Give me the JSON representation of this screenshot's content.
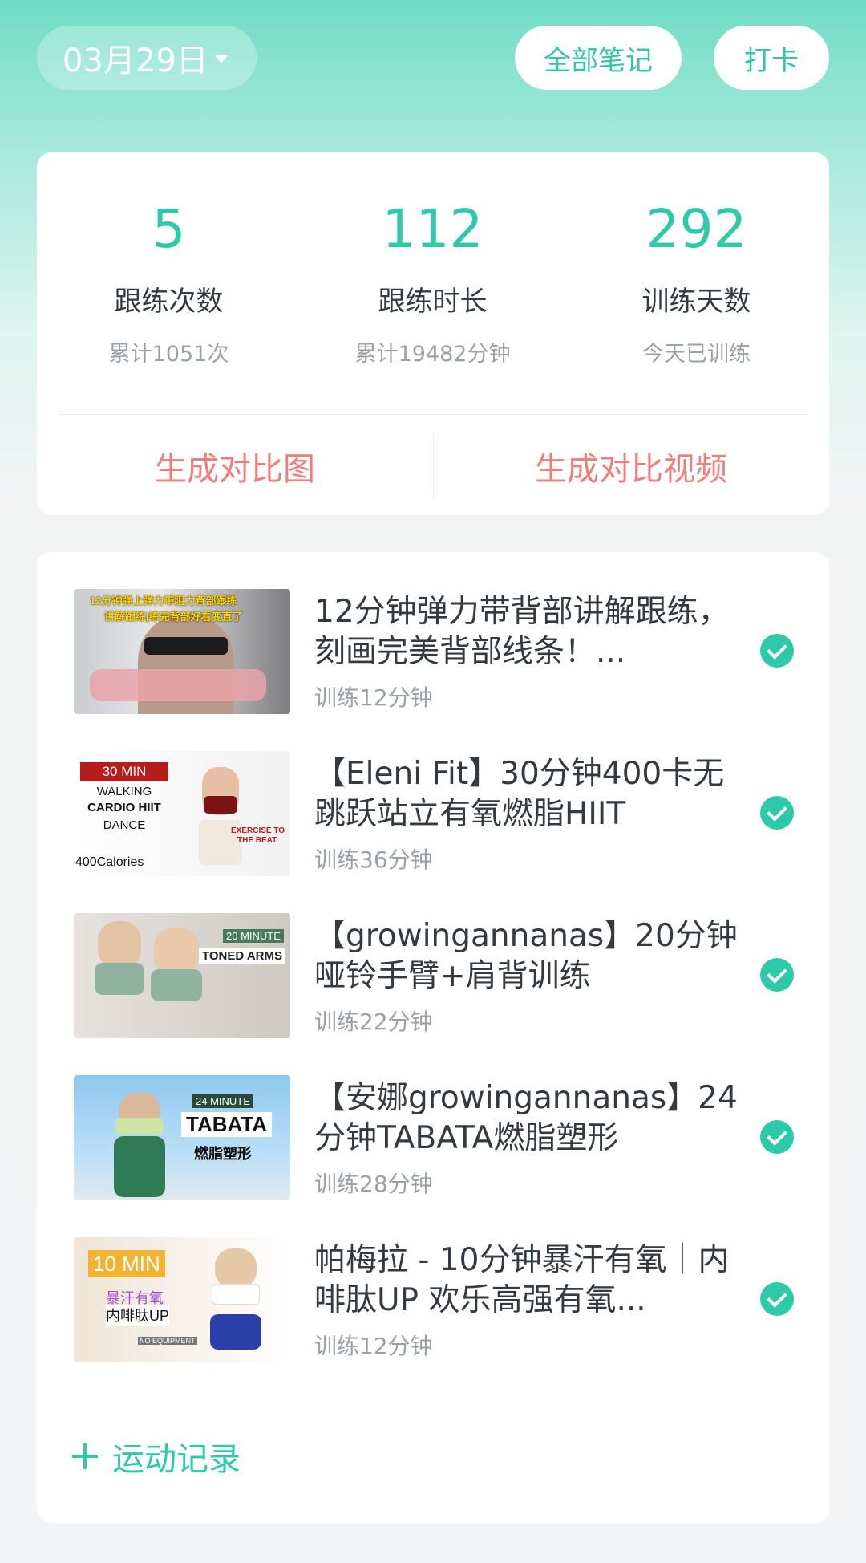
{
  "header": {
    "date": "03月29日",
    "all_notes": "全部笔记",
    "check_in": "打卡"
  },
  "stats": [
    {
      "value": "5",
      "label": "跟练次数",
      "sub": "累计1051次"
    },
    {
      "value": "112",
      "label": "跟练时长",
      "sub": "累计19482分钟"
    },
    {
      "value": "292",
      "label": "训练天数",
      "sub": "今天已训练"
    }
  ],
  "compare": {
    "image": "生成对比图",
    "video": "生成对比视频"
  },
  "workouts": [
    {
      "title": "12分钟弹力带背部讲解跟练，刻画完美背部线条！...",
      "sub": "训练12分钟",
      "thumb_text": [
        "12分钟弹上弹力带阻力背部跟练",
        "讲解跟练|练完背部好看变直了"
      ]
    },
    {
      "title": "【Eleni Fit】30分钟400卡无跳跃站立有氧燃脂HIIT",
      "sub": "训练36分钟",
      "thumb_text": [
        "30 MIN",
        "WALKING",
        "CARDIO HIIT",
        "DANCE",
        "EXERCISE TO",
        "THE BEAT",
        "400Calories"
      ]
    },
    {
      "title": "【growingannanas】20分钟哑铃手臂+肩背训练",
      "sub": "训练22分钟",
      "thumb_text": [
        "20 MINUTE",
        "TONED ARMS"
      ]
    },
    {
      "title": "【安娜growingannanas】24分钟TABATA燃脂塑形",
      "sub": "训练28分钟",
      "thumb_text": [
        "24 MINUTE",
        "TABATA",
        "燃脂塑形"
      ]
    },
    {
      "title": "帕梅拉 - 10分钟暴汗有氧｜内啡肽UP 欢乐高强有氧...",
      "sub": "训练12分钟",
      "thumb_text": [
        "10 MIN",
        "暴汗有氧",
        "内啡肽UP",
        "NO EQUIPMENT"
      ]
    }
  ],
  "add_record": "运动记录",
  "colors": {
    "accent": "#2ec9a8",
    "compare_text": "#f07c7c",
    "header_gradient_top": "#6fdcc5"
  }
}
